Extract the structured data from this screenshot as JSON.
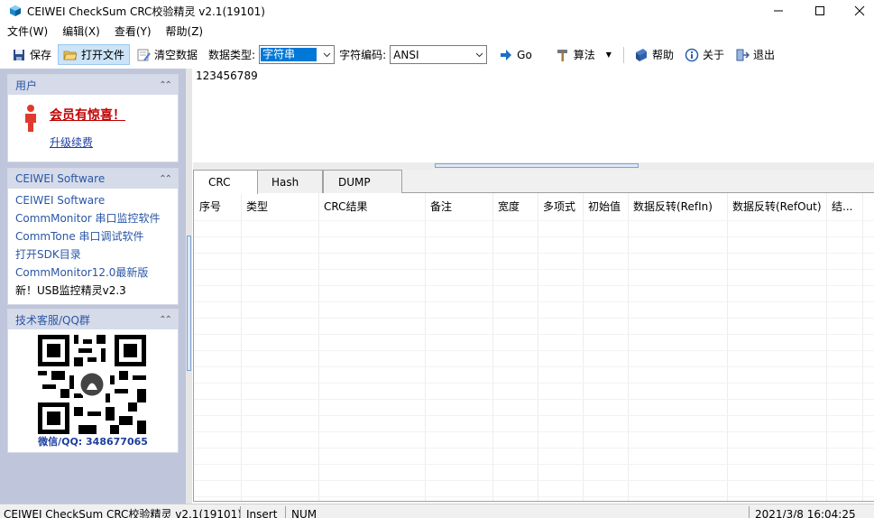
{
  "window": {
    "title": "CEIWEI CheckSum CRC校验精灵 v2.1(19101)",
    "minimize": "—",
    "maximize": "☐",
    "close": "✕"
  },
  "menu": {
    "items": [
      "文件(W)",
      "编辑(X)",
      "查看(Y)",
      "帮助(Z)"
    ]
  },
  "toolbar": {
    "save": "保存",
    "open": "打开文件",
    "clear": "清空数据",
    "data_type_label": "数据类型:",
    "data_type_value": "字符串",
    "encoding_label": "字符编码:",
    "encoding_value": "ANSI",
    "go": "Go",
    "algorithm": "算法",
    "help": "帮助",
    "about": "关于",
    "exit": "退出"
  },
  "sidebar": {
    "user_panel": {
      "title": "用户",
      "promo": "会员有惊喜！",
      "renew": "升级续费"
    },
    "software_panel": {
      "title": "CEIWEI Software",
      "links": [
        "CEIWEI Software",
        "CommMonitor 串口监控软件",
        "CommTone 串口调试软件",
        "打开SDK目录",
        "CommMonitor12.0最新版",
        "新！USB监控精灵v2.3"
      ]
    },
    "support_panel": {
      "title": "技术客服/QQ群",
      "caption": "微信/QQ: 348677065"
    }
  },
  "input": {
    "text": "123456789"
  },
  "tabs": [
    "CRC",
    "Hash",
    "DUMP"
  ],
  "table": {
    "columns": [
      "序号",
      "类型",
      "CRC结果",
      "备注",
      "宽度",
      "多项式",
      "初始值",
      "数据反转(RefIn)",
      "数据反转(RefOut)",
      "结..."
    ],
    "rows": []
  },
  "status": {
    "app": "CEIWEI CheckSum CRC校验精灵 v2.1(19101)",
    "mode": "Insert",
    "num": "NUM",
    "datetime": "2021/3/8 16:04:25"
  },
  "colors": {
    "accent": "#0078d7",
    "link": "#2a56a6",
    "promo": "#c00000",
    "sidebar_bg": "#bfc6db"
  }
}
